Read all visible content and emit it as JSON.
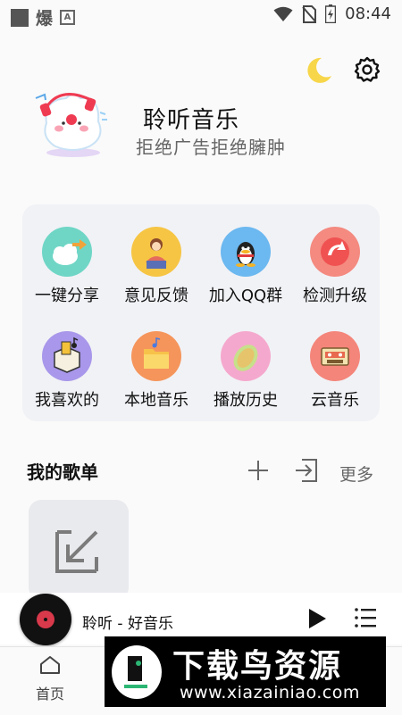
{
  "status_bar": {
    "left_glyph": "爆",
    "left_badge": "A",
    "time": "08:44"
  },
  "header": {
    "theme_toggle_icon": "moon-icon",
    "settings_icon": "gear-icon"
  },
  "hero": {
    "app_name": "聆听音乐",
    "slogan": "拒绝广告拒绝臃肿"
  },
  "grid": {
    "items": [
      {
        "label": "一键分享",
        "icon": "share-icon",
        "color": "#6fd6c6"
      },
      {
        "label": "意见反馈",
        "icon": "feedback-icon",
        "color": "#f6c544"
      },
      {
        "label": "加入QQ群",
        "icon": "qq-icon",
        "color": "#6cb8f0"
      },
      {
        "label": "检测升级",
        "icon": "upgrade-icon",
        "color": "#f48a80"
      },
      {
        "label": "我喜欢的",
        "icon": "favorite-icon",
        "color": "#a897ea"
      },
      {
        "label": "本地音乐",
        "icon": "local-music-icon",
        "color": "#f5955b"
      },
      {
        "label": "播放历史",
        "icon": "history-icon",
        "color": "#f5a8cd"
      },
      {
        "label": "云音乐",
        "icon": "cloud-music-icon",
        "color": "#f4857a"
      }
    ]
  },
  "playlists": {
    "title": "我的歌单",
    "more_label": "更多",
    "add_icon": "plus-icon",
    "import_icon": "import-icon"
  },
  "player": {
    "song_title": "聆听 - 好音乐",
    "play_icon": "play-icon",
    "queue_icon": "playlist-icon"
  },
  "tabbar": {
    "home_label": "首页"
  },
  "watermark": {
    "main": "下载鸟资源",
    "url": "www.xiazainiao.com"
  }
}
